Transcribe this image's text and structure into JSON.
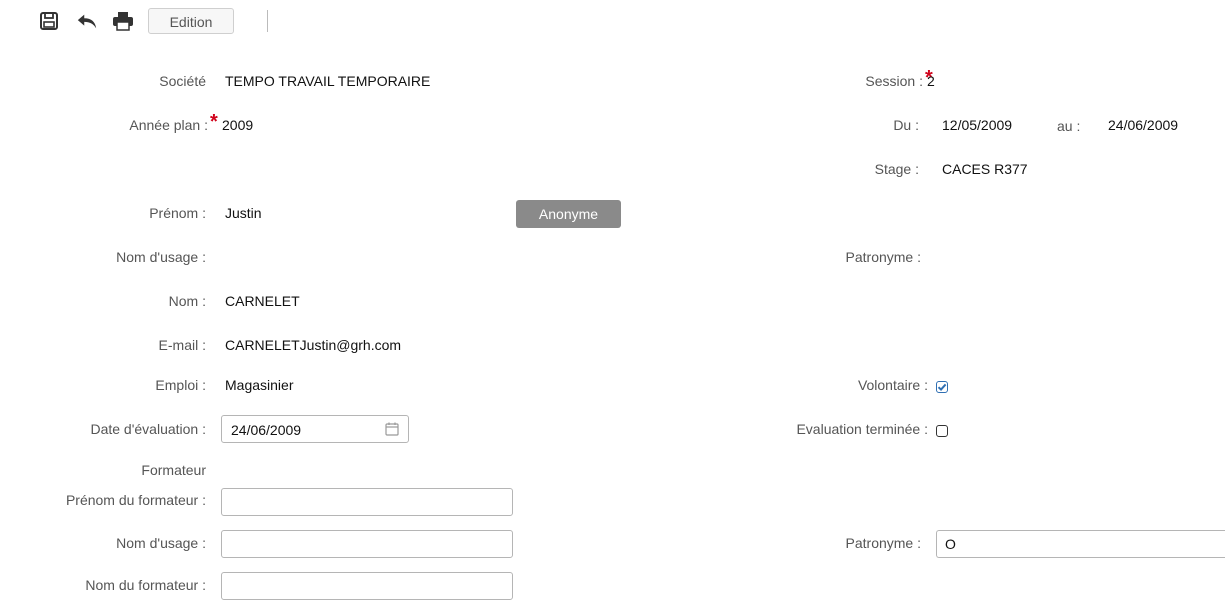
{
  "toolbar": {
    "save_icon": "save-icon",
    "undo_icon": "undo-icon",
    "print_icon": "print-icon",
    "edition_label": "Edition"
  },
  "form": {
    "societe": {
      "label": "Société",
      "value": "TEMPO TRAVAIL TEMPORAIRE"
    },
    "session": {
      "label": "Session :",
      "value": "2"
    },
    "annee_plan": {
      "label": "Année plan :",
      "value": "2009"
    },
    "du": {
      "label": "Du :",
      "value": "12/05/2009"
    },
    "au": {
      "label": "au :",
      "value": "24/06/2009"
    },
    "stage": {
      "label": "Stage :",
      "value": "CACES R377"
    },
    "prenom": {
      "label": "Prénom :",
      "value": "Justin"
    },
    "anonyme_label": "Anonyme",
    "nom_usage": {
      "label": "Nom d'usage :",
      "value": ""
    },
    "patronyme": {
      "label": "Patronyme :",
      "value": ""
    },
    "nom": {
      "label": "Nom :",
      "value": "CARNELET"
    },
    "email": {
      "label": "E-mail :",
      "value": "CARNELETJustin@grh.com"
    },
    "emploi": {
      "label": "Emploi :",
      "value": "Magasinier"
    },
    "volontaire": {
      "label": "Volontaire :",
      "checked": true
    },
    "date_evaluation": {
      "label": "Date d'évaluation :",
      "value": "24/06/2009"
    },
    "evaluation_terminee": {
      "label": "Evaluation terminée :",
      "checked": false
    },
    "required_mark": "*"
  },
  "formateur": {
    "section_label": "Formateur",
    "prenom": {
      "label": "Prénom du formateur :",
      "value": ""
    },
    "nom_usage": {
      "label": "Nom d'usage :",
      "value": ""
    },
    "patronyme": {
      "label": "Patronyme :",
      "value": "O"
    },
    "nom": {
      "label": "Nom du formateur :",
      "value": ""
    }
  },
  "colors": {
    "required": "#d0021b",
    "checkbox_checked": "#2f6fb3",
    "anon_button": "#8a8a8a"
  }
}
